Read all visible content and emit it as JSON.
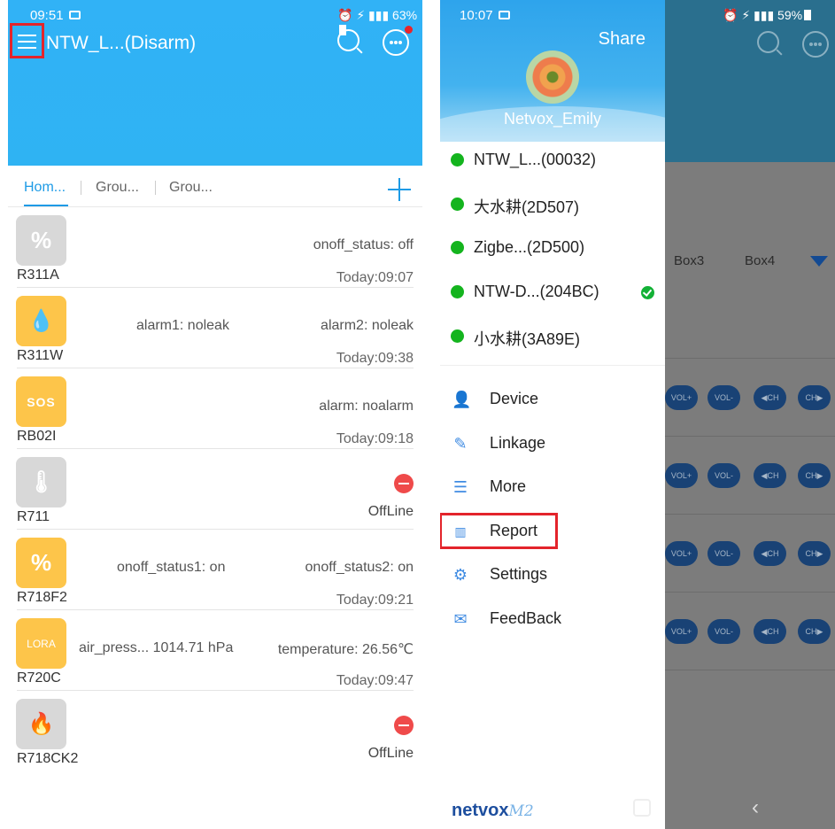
{
  "left": {
    "status_time": "09:51",
    "status_right": "63%",
    "title": "NTW_L...(Disarm)",
    "tabs": [
      "Hom...",
      "Grou...",
      "Grou..."
    ],
    "devices": [
      {
        "icon": "percent-icon",
        "color": "gray",
        "name": "R311A",
        "attrs": [
          {
            "text": "onoff_status: off"
          }
        ],
        "time": "Today:09:07"
      },
      {
        "icon": "water-drop-alert-icon",
        "color": "yellow",
        "name": "R311W",
        "attrs": [
          {
            "text": "alarm1: noleak"
          },
          {
            "text": "alarm2: noleak"
          }
        ],
        "time": "Today:09:38"
      },
      {
        "icon_text": "SOS",
        "color": "yellow",
        "name": "RB02I",
        "attrs": [
          {
            "text": "alarm: noalarm"
          }
        ],
        "time": "Today:09:18"
      },
      {
        "icon": "thermometer-icon",
        "color": "gray",
        "name": "R711",
        "offline": "OffLine"
      },
      {
        "icon": "percent-icon",
        "color": "yellow",
        "name": "R718F2",
        "attrs": [
          {
            "text": "onoff_status1: on"
          },
          {
            "text": "onoff_status2: on"
          }
        ],
        "time": "Today:09:21"
      },
      {
        "icon_text": "LORA",
        "color": "yellow",
        "name": "R720C",
        "attrs": [
          {
            "text": "air_press... 1014.71 hPa"
          },
          {
            "text": "temperature: 26.56℃"
          }
        ],
        "time": "Today:09:47"
      },
      {
        "icon": "flame-icon",
        "color": "gray",
        "name": "R718CK2",
        "offline": "OffLine"
      }
    ]
  },
  "right": {
    "status_time": "10:07",
    "status_right": "59%",
    "share": "Share",
    "user": "Netvox_Emily",
    "gateways": [
      "NTW_L...(00032)",
      "大水耕(2D507)",
      "Zigbe...(2D500)",
      "NTW-D...(204BC)",
      "小水耕(3A89E)"
    ],
    "menu": [
      {
        "icon": "user-device-icon",
        "label": "Device"
      },
      {
        "icon": "pencil-icon",
        "label": "Linkage"
      },
      {
        "icon": "list-icon",
        "label": "More"
      },
      {
        "icon": "bar-chart-icon",
        "label": "Report"
      },
      {
        "icon": "gear-icon",
        "label": "Settings"
      },
      {
        "icon": "envelope-icon",
        "label": "FeedBack"
      }
    ],
    "background_tabs": [
      "Box3",
      "Box4"
    ],
    "controls": [
      "VOL+",
      "VOL-",
      "◀CH",
      "CH▶"
    ],
    "logo": "netvox",
    "logo_suffix": "M2"
  }
}
